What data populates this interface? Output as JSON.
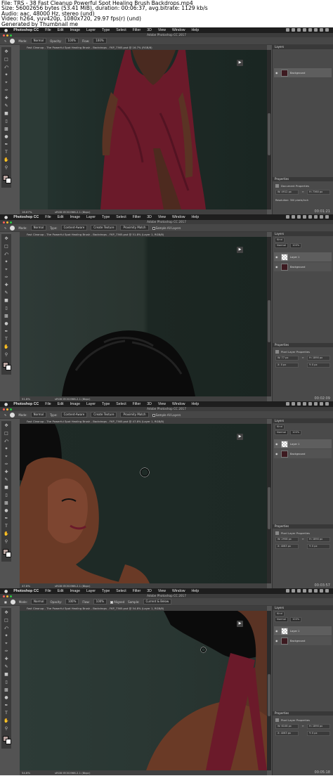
{
  "header": {
    "lines": [
      "File: TRS - 38 Fast Cleanup Powerful Spot Healing Brush Backdrops.mp4",
      "Size: 56002656 bytes (53.41 MiB), duration: 00:06:37, avg.bitrate: 1129 kb/s",
      "Audio: aac, 48000 Hz, stereo (und)",
      "Video: h264, yuv420p, 1080x720, 29.97 fps(r) (und)",
      "Generated by Thumbnail me"
    ]
  },
  "menu": {
    "app": "Photoshop CC",
    "items": [
      "File",
      "Edit",
      "Image",
      "Layer",
      "Type",
      "Select",
      "Filter",
      "3D",
      "View",
      "Window",
      "Help"
    ]
  },
  "window_title": "Adobe Photoshop CC 2017",
  "frames": [
    {
      "timecode": "00:01:21",
      "tab": "Fast Cleanup - The Powerful Spot Healing Brush - Backdrops - FKP_7365.psd @ 16.7% (RGB/8)",
      "zoom": "16.67%",
      "doc": "sRGB IEC61966-2.1 (8bpc)",
      "options": {
        "mode_label": "Mode:",
        "mode_value": "Normal",
        "opacity_label": "Opacity:",
        "opacity_value": "100%",
        "flow_label": "Flow:",
        "flow_value": "100%"
      },
      "layers": [
        {
          "name": "Background",
          "selected": true
        }
      ],
      "props_title": "Document Properties",
      "props": {
        "w": "W: 4912 px",
        "h": "H: 7360 px",
        "x": "X:",
        "y": "Y:",
        "res": "Resolution: 300 pixels/inch"
      }
    },
    {
      "timecode": "00:02:09",
      "tab": "Fast Cleanup - The Powerful Spot Healing Brush - Backdrops - FKP_7365.psd @ 51.8% (Layer 1, RGB/8)",
      "zoom": "51.8%",
      "doc": "sRGB IEC61966-2.1 (8bpc)",
      "options": {
        "mode_label": "Mode:",
        "mode_value": "Normal",
        "type_label": "Type:",
        "type_a": "Content-Aware",
        "type_b": "Create Texture",
        "type_c": "Proximity Match",
        "sample": "Sample All Layers"
      },
      "layer_kind": "Kind",
      "blend": "Normal",
      "opacity": "100%",
      "layers": [
        {
          "name": "Layer 1",
          "selected": true
        },
        {
          "name": "Background",
          "selected": false
        }
      ],
      "props_title": "Pixel Layer Properties",
      "props": {
        "w": "W: 77 px",
        "h": "H: 1890 px",
        "x": "X: 0 px",
        "y": "Y: 0 px"
      }
    },
    {
      "timecode": "00:03:57",
      "tab": "Fast Cleanup - The Powerful Spot Healing Brush - Backdrops - FKP_7365.psd @ 47.8% (Layer 1, RGB/8)",
      "zoom": "47.8%",
      "doc": "sRGB IEC61966-2.1 (8bpc)",
      "options": {
        "mode_label": "Mode:",
        "mode_value": "Normal",
        "type_label": "Type:",
        "type_a": "Content-Aware",
        "type_b": "Create Texture",
        "type_c": "Proximity Match",
        "sample": "Sample All Layers"
      },
      "layer_kind": "Kind",
      "blend": "Normal",
      "opacity": "100%",
      "layers": [
        {
          "name": "Layer 1",
          "selected": true
        },
        {
          "name": "Background",
          "selected": false
        }
      ],
      "props_title": "Pixel Layer Properties",
      "props": {
        "w": "W: 2958 px",
        "h": "H: 1890 px",
        "x": "X: 4063 px",
        "y": "Y: 0 px"
      }
    },
    {
      "timecode": "00:05:18",
      "tab": "Fast Cleanup - The Powerful Spot Healing Brush - Backdrops - FKP_7365.psd @ 54.8% (Layer 1, RGB/8)",
      "zoom": "54.8%",
      "doc": "sRGB IEC61966-2.1 (8bpc)",
      "options": {
        "mode_label": "Mode:",
        "mode_value": "Normal",
        "opacity_label": "Opacity:",
        "opacity_value": "100%",
        "flow_label": "Flow:",
        "flow_value": "100%",
        "aligned": "Aligned",
        "sample_label": "Sample:",
        "sample_value": "Current & Below"
      },
      "layer_kind": "Kind",
      "blend": "Normal",
      "opacity": "100%",
      "layers": [
        {
          "name": "Layer 1",
          "selected": true
        },
        {
          "name": "Background",
          "selected": false
        }
      ],
      "props_title": "Pixel Layer Properties",
      "props": {
        "w": "W: 6108 px",
        "h": "H: 1890 px",
        "x": "X: 4063 px",
        "y": "Y: 0 px"
      }
    }
  ],
  "panel_labels": {
    "layers": "Layers",
    "properties": "Properties"
  },
  "colors": {
    "backdrop": "#1f2b27",
    "dress": "#6b1a2a",
    "skin": "#5a3324",
    "ui_dark": "#535353"
  }
}
